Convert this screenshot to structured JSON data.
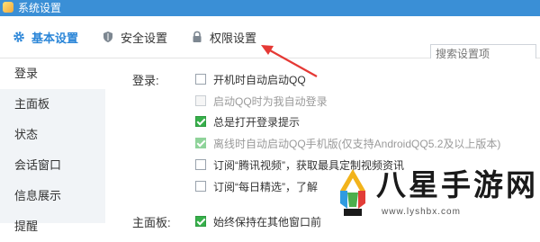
{
  "window": {
    "title": "系统设置"
  },
  "tabs": [
    {
      "label": "基本设置",
      "icon": "gear-icon",
      "active": true
    },
    {
      "label": "安全设置",
      "icon": "shield-icon",
      "active": false
    },
    {
      "label": "权限设置",
      "icon": "lock-icon",
      "active": false
    }
  ],
  "search": {
    "placeholder": "搜索设置项"
  },
  "sidebar": {
    "items": [
      {
        "label": "登录",
        "active": true
      },
      {
        "label": "主面板"
      },
      {
        "label": "状态"
      },
      {
        "label": "会话窗口"
      },
      {
        "label": "信息展示"
      },
      {
        "label": "提醒"
      }
    ]
  },
  "login_section": {
    "label": "登录:",
    "options": [
      {
        "text": "开机时自动启动QQ",
        "checked": false,
        "disabled": false
      },
      {
        "text": "启动QQ时为我自动登录",
        "checked": false,
        "disabled": true
      },
      {
        "text": "总是打开登录提示",
        "checked": true,
        "disabled": false
      },
      {
        "text": "离线时自动启动QQ手机版(仅支持AndroidQQ5.2及以上版本)",
        "checked": true,
        "disabled": true
      },
      {
        "text": "订阅“腾讯视频”，获取最具定制视频资讯",
        "checked": false,
        "disabled": false
      },
      {
        "text": "订阅“每日精选”，了解",
        "checked": false,
        "disabled": false
      }
    ]
  },
  "panel_section": {
    "label": "主面板:",
    "option": {
      "text": "始终保持在其他窗口前",
      "checked": true
    }
  },
  "watermark": {
    "cn": "八星手游网",
    "url": "www.lyshbx.com"
  },
  "colors": {
    "titlebar": "#3a8fd6",
    "accent": "#2b86d8",
    "check": "#36b04a",
    "arrow": "#e53935"
  }
}
